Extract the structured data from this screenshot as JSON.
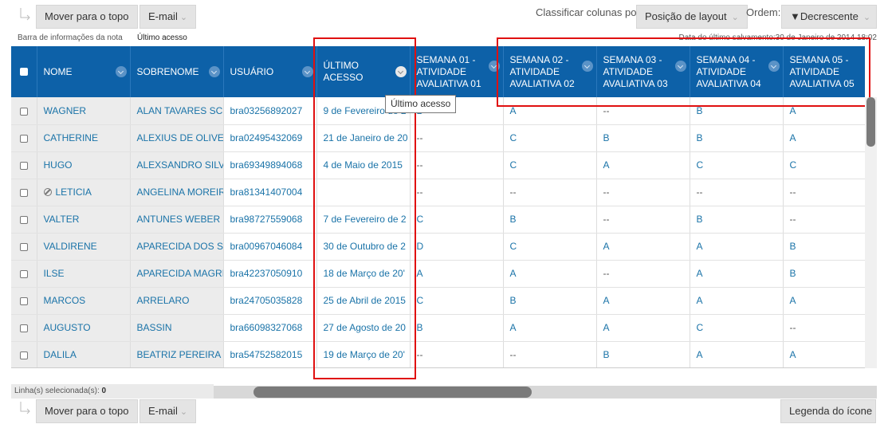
{
  "toolbar": {
    "move_top_label": "Mover para o topo",
    "email_label": "E-mail",
    "sort_columns_label": "Classificar colunas por:",
    "sort_by_value": "Posição de layout",
    "order_label": "Ordem:",
    "order_value": "▼Decrescente",
    "icon_legend_label": "Legenda do ícone"
  },
  "infobar": {
    "tab1": "Barra de informações da nota",
    "tab2": "Último acesso",
    "last_saved": "Data do último salvamento:30 de Janeiro de 2014 18:02"
  },
  "columns": {
    "nome": "NOME",
    "sobrenome": "SOBRENOME",
    "usuario": "USUÁRIO",
    "ultimo_acesso": "ÚLTIMO ACESSO",
    "s1": "SEMANA 01 - ATIVIDADE AVALIATIVA 01",
    "s2": "SEMANA 02 - ATIVIDADE AVALIATIVA 02",
    "s3": "SEMANA 03 - ATIVIDADE AVALIATIVA 03",
    "s4": "SEMANA 04 - ATIVIDADE AVALIATIVA 04",
    "s5": "SEMANA 05 - ATIVIDADE AVALIATIVA 05"
  },
  "rows": [
    {
      "nome": "WAGNER",
      "sobrenome": "ALAN TAVARES SCH",
      "usuario": "bra03256892027",
      "acesso": "9 de Fevereiro de 2",
      "s1": "B",
      "s2": "A",
      "s3": "--",
      "s4": "B",
      "s5": "A"
    },
    {
      "nome": "CATHERINE",
      "sobrenome": "ALEXIUS DE OLIVEIF",
      "usuario": "bra02495432069",
      "acesso": "21 de Janeiro de 20",
      "s1": "--",
      "s2": "C",
      "s3": "B",
      "s4": "B",
      "s5": "A"
    },
    {
      "nome": "HUGO",
      "sobrenome": "ALEXSANDRO SILVA",
      "usuario": "bra69349894068",
      "acesso": "4 de Maio de 2015",
      "s1": "--",
      "s2": "C",
      "s3": "A",
      "s4": "C",
      "s5": "C"
    },
    {
      "nome": "LETICIA",
      "sobrenome": "ANGELINA MOREIR.",
      "usuario": "bra81341407004",
      "acesso": "",
      "s1": "--",
      "s2": "--",
      "s3": "--",
      "s4": "--",
      "s5": "--"
    },
    {
      "nome": "VALTER",
      "sobrenome": "ANTUNES WEBER",
      "usuario": "bra98727559068",
      "acesso": "7 de Fevereiro de 2",
      "s1": "C",
      "s2": "B",
      "s3": "--",
      "s4": "B",
      "s5": "--"
    },
    {
      "nome": "VALDIRENE",
      "sobrenome": "APARECIDA DOS SA",
      "usuario": "bra00967046084",
      "acesso": "30 de Outubro de 2",
      "s1": "D",
      "s2": "C",
      "s3": "A",
      "s4": "A",
      "s5": "B"
    },
    {
      "nome": "ILSE",
      "sobrenome": "APARECIDA MAGRII",
      "usuario": "bra42237050910",
      "acesso": "18 de Março de 20'",
      "s1": "A",
      "s2": "A",
      "s3": "--",
      "s4": "A",
      "s5": "B"
    },
    {
      "nome": "MARCOS",
      "sobrenome": "ARRELARO",
      "usuario": "bra24705035828",
      "acesso": "25 de Abril de 2015",
      "s1": "C",
      "s2": "B",
      "s3": "A",
      "s4": "A",
      "s5": "A"
    },
    {
      "nome": "AUGUSTO",
      "sobrenome": "BASSIN",
      "usuario": "bra66098327068",
      "acesso": "27 de Agosto de 20",
      "s1": "B",
      "s2": "A",
      "s3": "A",
      "s4": "C",
      "s5": "--"
    },
    {
      "nome": "DALILA",
      "sobrenome": "BEATRIZ PEREIRA PI",
      "usuario": "bra54752582015",
      "acesso": "19 de Março de 20'",
      "s1": "--",
      "s2": "--",
      "s3": "B",
      "s4": "A",
      "s5": "A"
    }
  ],
  "tooltip": "Último acesso",
  "status": {
    "label": "Linha(s) selecionada(s): ",
    "count": "0"
  },
  "colors": {
    "header_bg": "#0d61a8",
    "link": "#1a73a8",
    "highlight": "#e01010"
  }
}
